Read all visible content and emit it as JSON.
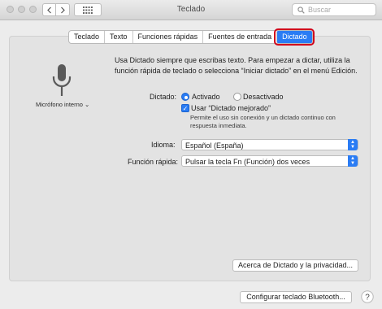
{
  "window": {
    "title": "Teclado"
  },
  "search": {
    "placeholder": "Buscar"
  },
  "tabs": [
    {
      "label": "Teclado"
    },
    {
      "label": "Texto"
    },
    {
      "label": "Funciones rápidas"
    },
    {
      "label": "Fuentes de entrada"
    },
    {
      "label": "Dictado",
      "selected": true
    }
  ],
  "microphone": {
    "label": "Micrófono interno ⌄"
  },
  "intro_text": "Usa Dictado siempre que escribas texto. Para empezar a dictar, utiliza la función rápida de teclado o selecciona “Iniciar dictado” en el menú Edición.",
  "dictation": {
    "label": "Dictado:",
    "option_on": "Activado",
    "option_off": "Desactivado",
    "selected": "Activado",
    "enhanced_label": "Usar “Dictado mejorado”",
    "enhanced_checked": true,
    "enhanced_hint": "Permite el uso sin conexión y un dictado continuo con respuesta inmediata."
  },
  "language": {
    "label": "Idioma:",
    "value": "Español (España)"
  },
  "shortcut": {
    "label": "Función rápida:",
    "value": "Pulsar la tecla Fn (Función) dos veces"
  },
  "buttons": {
    "about": "Acerca de Dictado y la privacidad...",
    "bluetooth": "Configurar teclado Bluetooth..."
  },
  "colors": {
    "accent": "#2a7cf4",
    "highlight": "#d0021b"
  }
}
